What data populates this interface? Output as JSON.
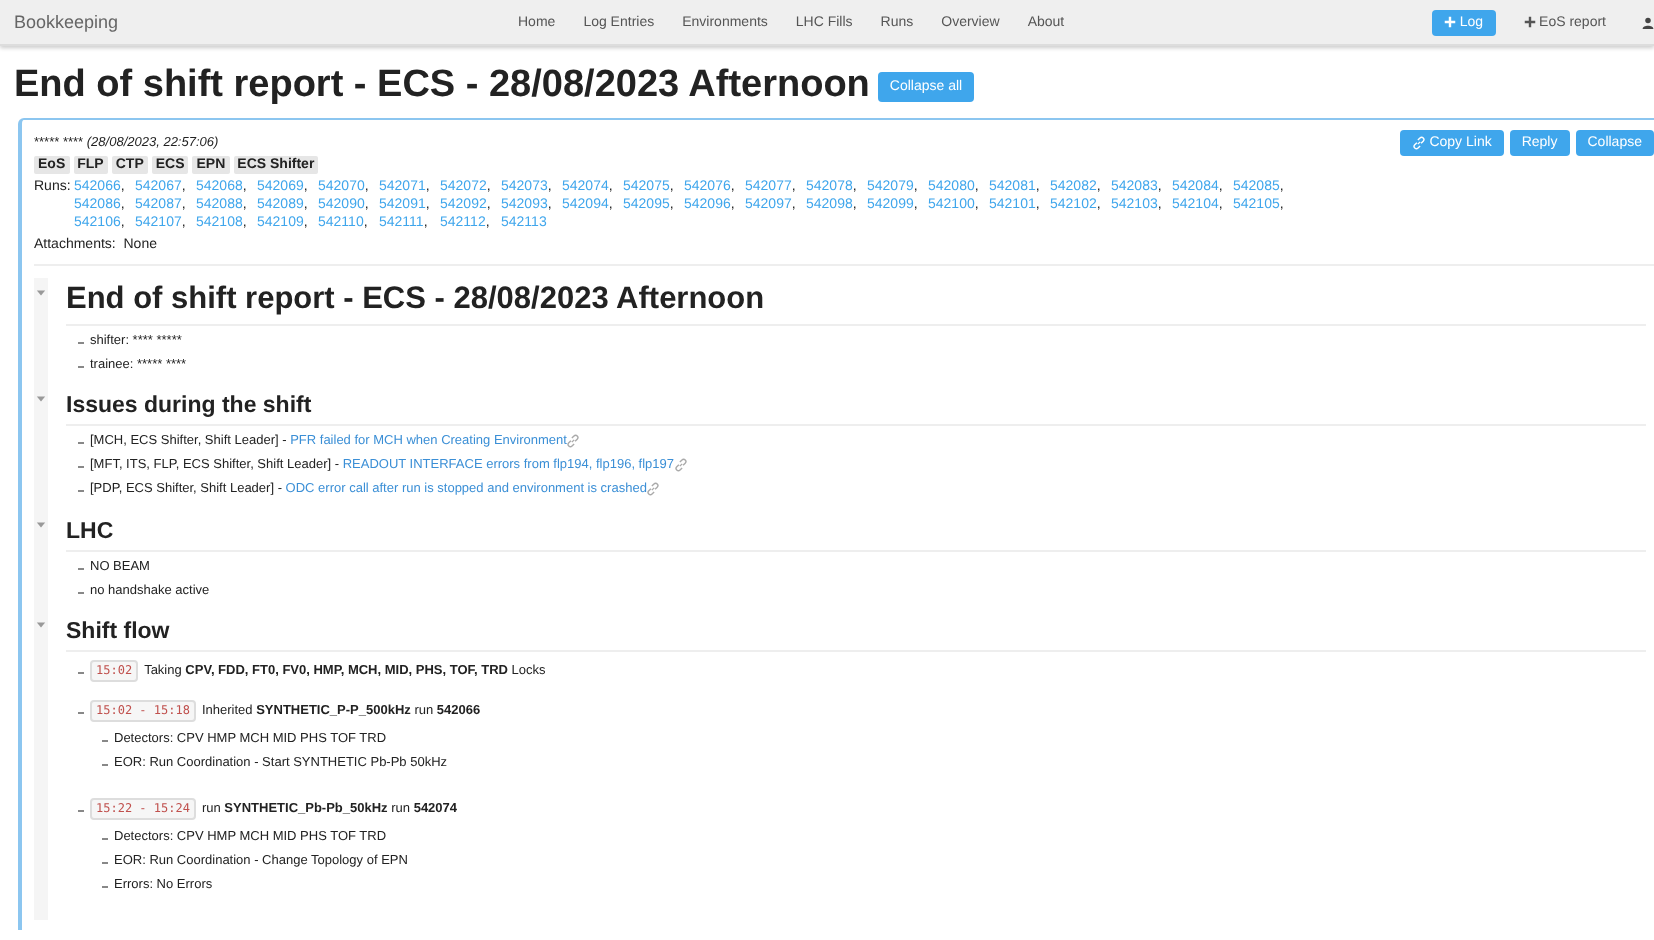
{
  "nav": {
    "brand": "Bookkeeping",
    "links": [
      "Home",
      "Log Entries",
      "Environments",
      "LHC Fills",
      "Runs",
      "Overview",
      "About"
    ],
    "buttons": [
      {
        "label": "Log",
        "kind": "primary"
      },
      {
        "label": "EoS report",
        "kind": "plain"
      }
    ]
  },
  "title": "End of shift report - ECS - 28/08/2023 Afternoon",
  "collapse_all": "Collapse all",
  "entry": {
    "author": "***** ****",
    "date": "(28/08/2023, 22:57:06)",
    "tags": [
      "EoS",
      "FLP",
      "CTP",
      "ECS",
      "EPN",
      "ECS Shifter"
    ],
    "runs_label": "Runs:",
    "runs_separator": ",",
    "runs": [
      "542066",
      "542067",
      "542068",
      "542069",
      "542070",
      "542071",
      "542072",
      "542073",
      "542074",
      "542075",
      "542076",
      "542077",
      "542078",
      "542079",
      "542080",
      "542081",
      "542082",
      "542083",
      "542084",
      "542085",
      "542086",
      "542087",
      "542088",
      "542089",
      "542090",
      "542091",
      "542092",
      "542093",
      "542094",
      "542095",
      "542096",
      "542097",
      "542098",
      "542099",
      "542100",
      "542101",
      "542102",
      "542103",
      "542104",
      "542105",
      "542106",
      "542107",
      "542108",
      "542109",
      "542110",
      "542111",
      "542112",
      "542113"
    ],
    "attachments_label": "Attachments:",
    "attachments": "None",
    "actions": [
      {
        "label": "Copy Link",
        "kind": "link"
      },
      {
        "label": "Reply",
        "kind": "plain"
      },
      {
        "label": "Collapse",
        "kind": "plain"
      }
    ]
  },
  "sections": [
    {
      "kind": "title",
      "title": "End of shift report - ECS - 28/08/2023 Afternoon",
      "expanded": true,
      "items": [
        {
          "kind": "plain",
          "text": "shifter: **** *****"
        },
        {
          "kind": "plain",
          "text": "trainee: ***** ****"
        }
      ]
    },
    {
      "kind": "heading",
      "title": "Issues during the shift",
      "expanded": true,
      "items": [
        {
          "kind": "issue",
          "text": "[MCH, ECS Shifter, Shift Leader] -",
          "link": "PFR failed for MCH when Creating Environment"
        },
        {
          "kind": "issue",
          "text": "[MFT, ITS, FLP, ECS Shifter, Shift Leader] -",
          "link": "READOUT INTERFACE errors from flp194, flp196, flp197"
        },
        {
          "kind": "issue",
          "text": "[PDP, ECS Shifter, Shift Leader] -",
          "link": "ODC error call after run is stopped and environment is crashed"
        }
      ]
    },
    {
      "kind": "heading",
      "title": "LHC",
      "expanded": true,
      "items": [
        {
          "kind": "plain",
          "text": "NO BEAM"
        },
        {
          "kind": "plain",
          "text": "no handshake active"
        }
      ]
    },
    {
      "kind": "heading",
      "title": "Shift flow",
      "expanded": true,
      "items": [
        {
          "kind": "flow",
          "time": "15:02",
          "text": "Taking **CPV, FDD, FT0, FV0, HMP, MCH, MID, PHS, TOF, TRD** Locks"
        },
        {
          "kind": "flow",
          "time": "15:02 - 15:18",
          "text": "Inherited **SYNTHETIC_P-P_500kHz** run **542066**",
          "children": [
            "Detectors: CPV HMP MCH MID PHS TOF TRD",
            "EOR: Run Coordination - Start SYNTHETIC Pb-Pb 50kHz"
          ]
        },
        {
          "kind": "flow",
          "time": "15:22 - 15:24",
          "text": "run **SYNTHETIC_Pb-Pb_50kHz** run **542074**",
          "children": [
            "Detectors: CPV HMP MCH MID PHS TOF TRD",
            "EOR: Run Coordination - Change Topology of EPN",
            "Errors: No Errors"
          ]
        }
      ]
    }
  ]
}
